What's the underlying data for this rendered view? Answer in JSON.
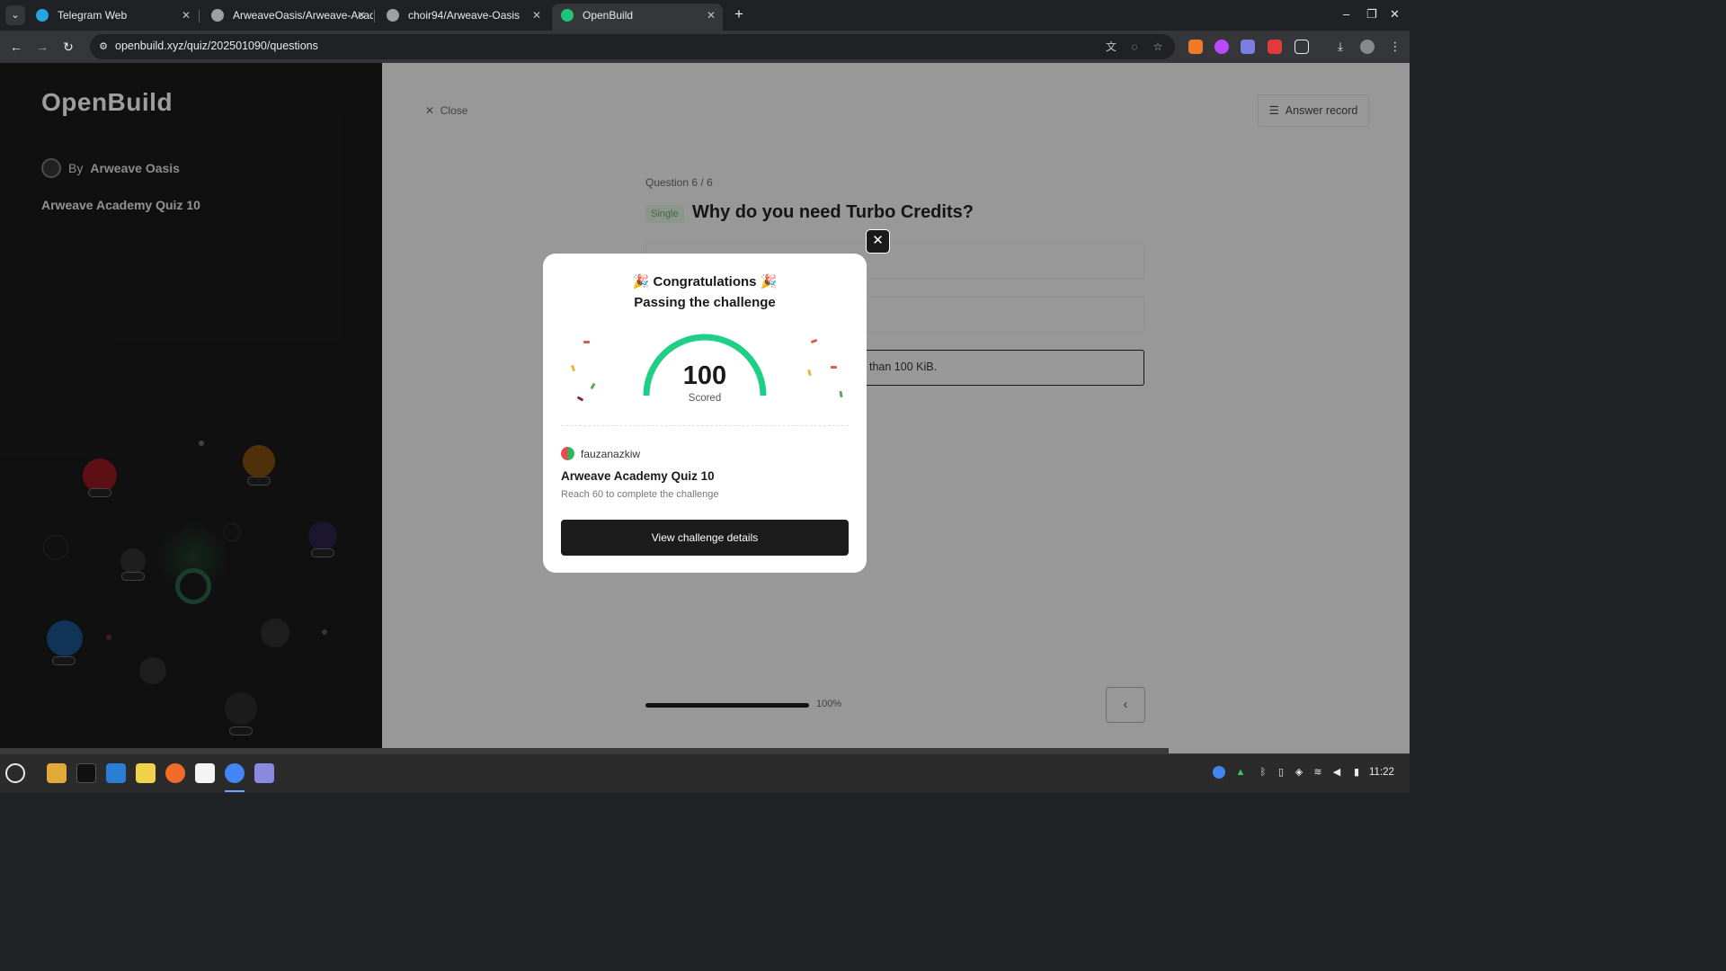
{
  "browser": {
    "tabs": [
      {
        "title": "Telegram Web",
        "favicon_color": "#2aa3e0"
      },
      {
        "title": "ArweaveOasis/Arweave-Acad",
        "favicon_color": "#9aa0a6"
      },
      {
        "title": "choir94/Arweave-Oasis",
        "favicon_color": "#9aa0a6"
      },
      {
        "title": "OpenBuild",
        "favicon_color": "#20c478"
      }
    ],
    "url": "openbuild.xyz/quiz/202501090/questions"
  },
  "sidebar": {
    "logo": "OpenBuild",
    "by_prefix": "By",
    "author": "Arweave Oasis",
    "quiz_name": "Arweave Academy Quiz 10"
  },
  "main": {
    "close_label": "Close",
    "answer_record_label": "Answer record",
    "question_counter": "Question 6 / 6",
    "question_type": "Single",
    "question_title": "Why do you need Turbo Credits?",
    "selected_option_text": "than 100 KiB.",
    "progress": {
      "value": 1.0,
      "label": "100%"
    }
  },
  "modal": {
    "heading": "🎉 Congratulations 🎉",
    "subheading": "Passing the challenge",
    "score": "100",
    "score_label": "Scored",
    "username": "fauzanazkiw",
    "quiz_title": "Arweave Academy Quiz 10",
    "requirement": "Reach 60 to complete the challenge",
    "button_label": "View challenge details",
    "gauge_color": "#1fcf85"
  },
  "taskbar": {
    "time": "11:22"
  }
}
